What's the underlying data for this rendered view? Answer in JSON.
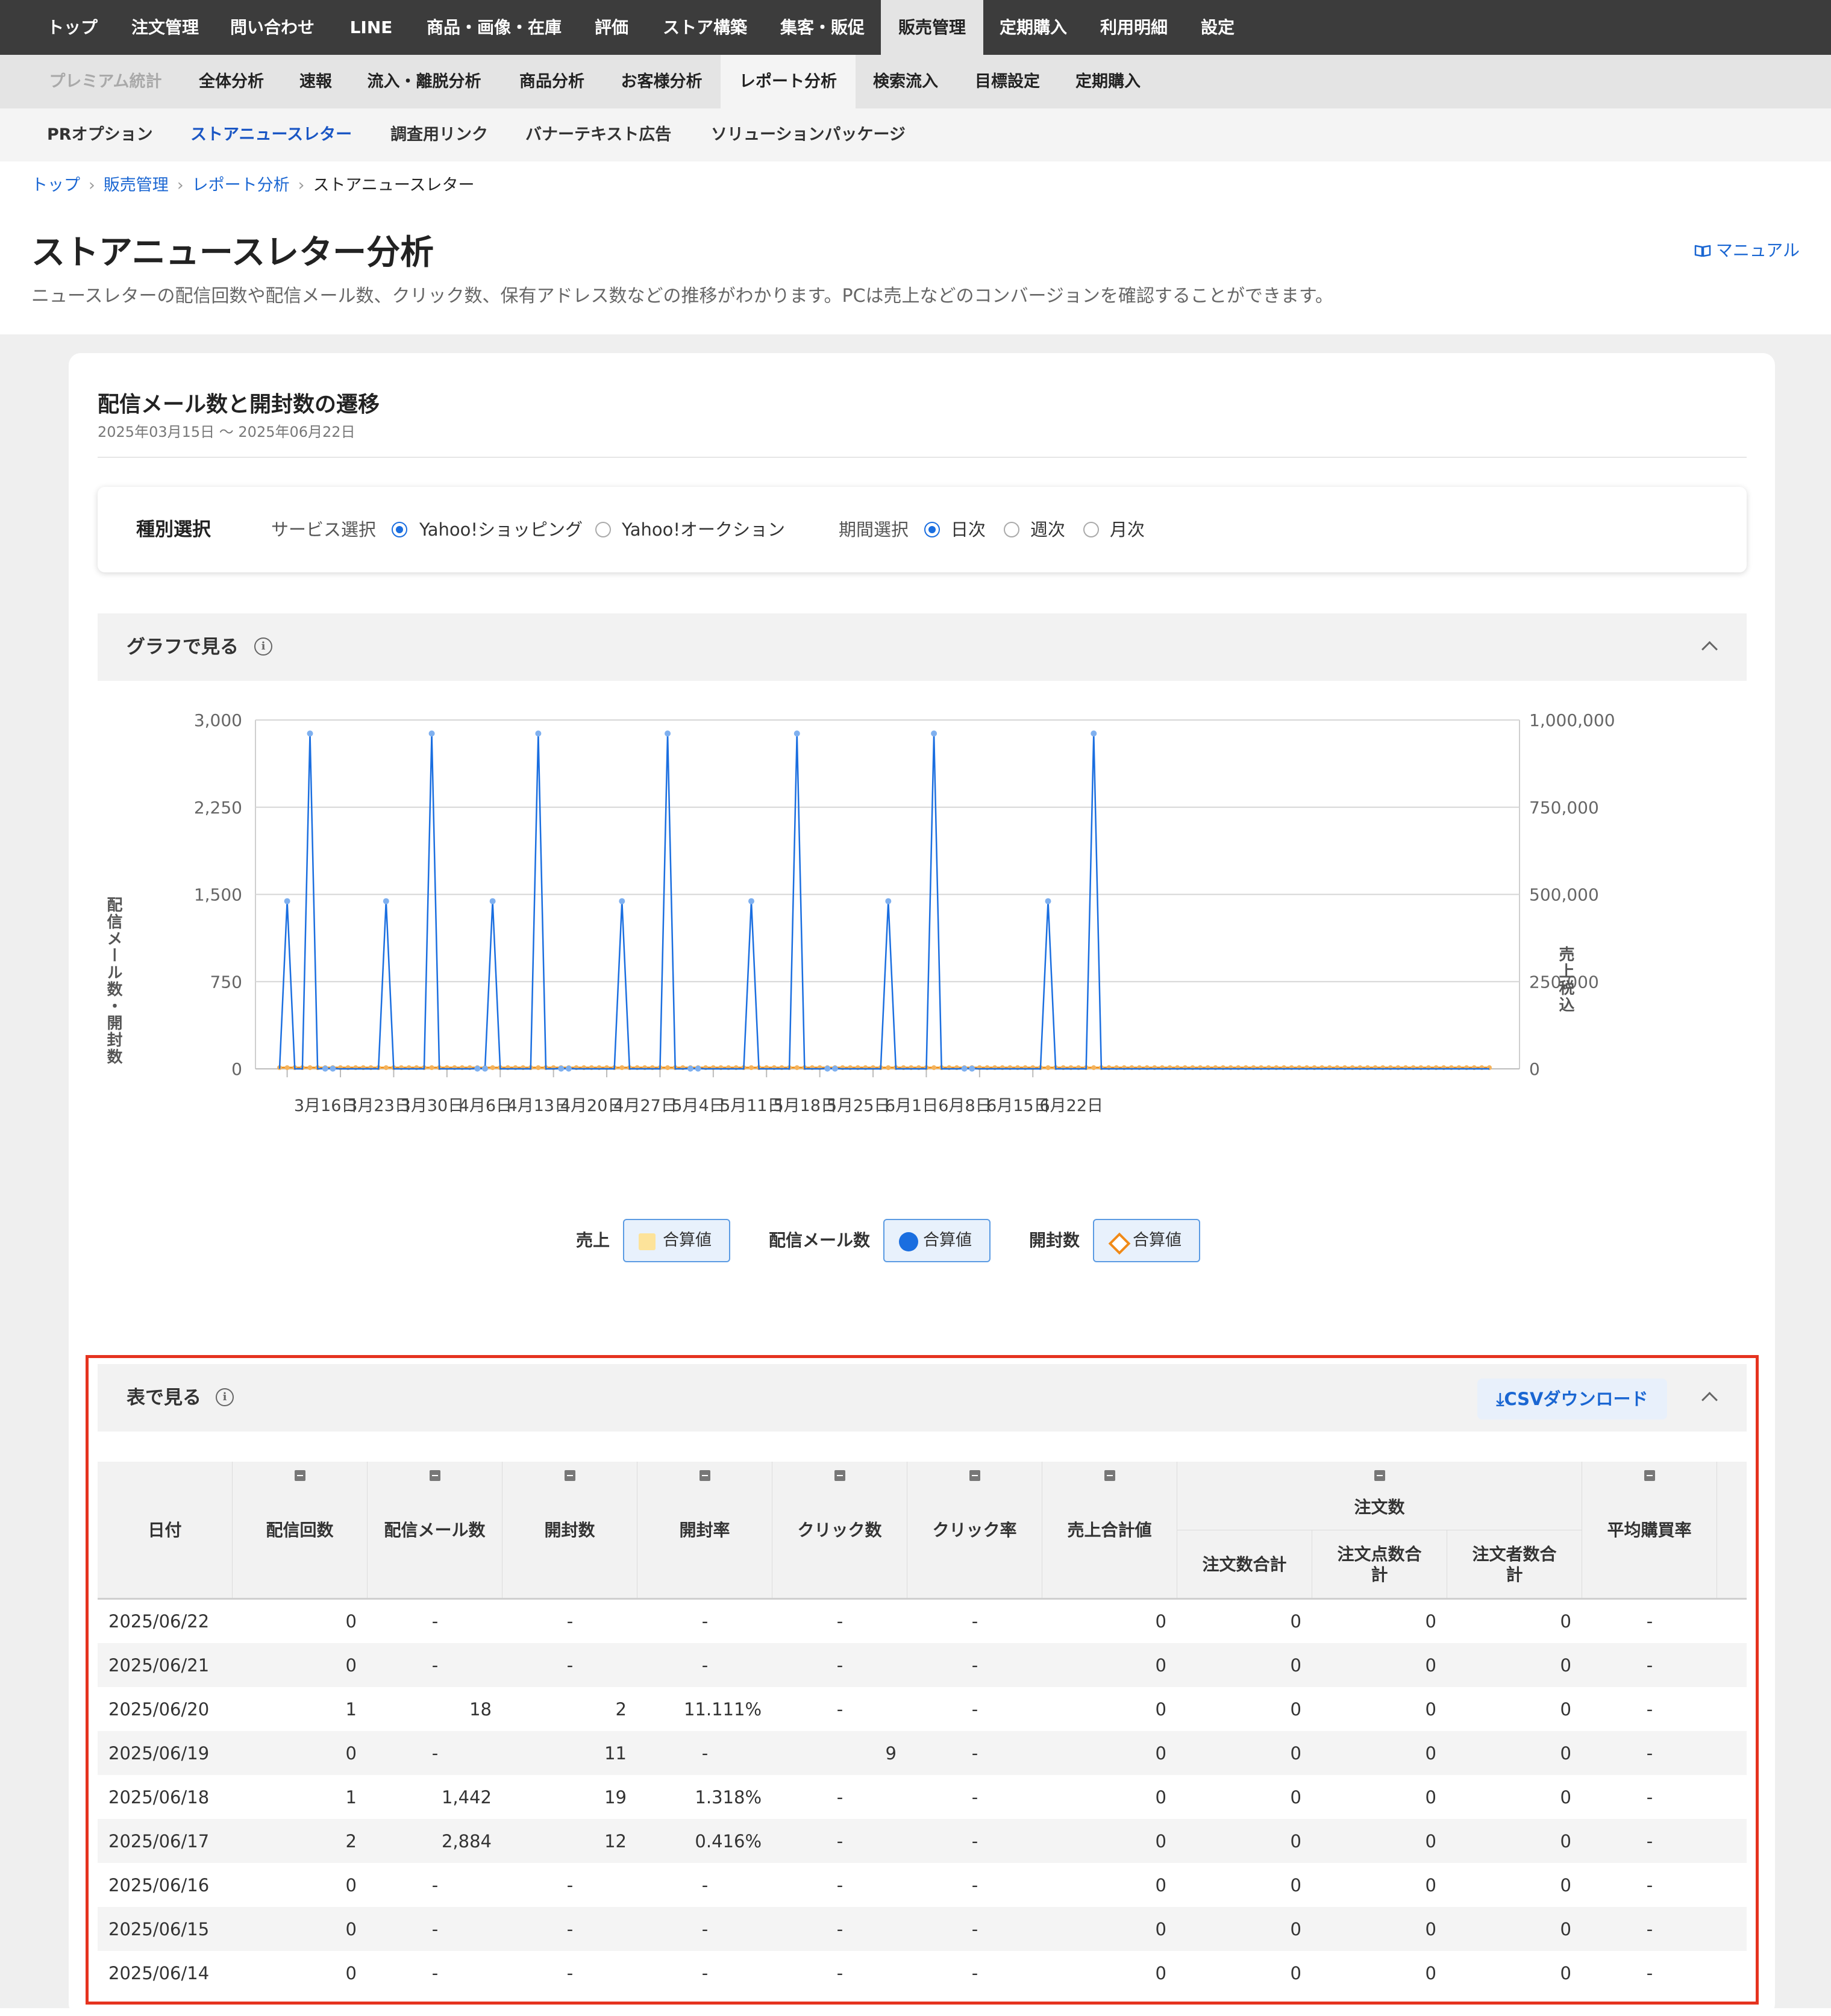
{
  "nav": {
    "main": [
      "トップ",
      "注文管理",
      "問い合わせ",
      "LINE",
      "商品・画像・在庫",
      "評価",
      "ストア構築",
      "集客・販促",
      "販売管理",
      "定期購入",
      "利用明細",
      "設定"
    ],
    "main_active": "販売管理",
    "sub": [
      "プレミアム統計",
      "全体分析",
      "速報",
      "流入・離脱分析",
      "商品分析",
      "お客様分析",
      "レポート分析",
      "検索流入",
      "目標設定",
      "定期購入"
    ],
    "sub_active": "レポート分析",
    "third": [
      "PRオプション",
      "ストアニュースレター",
      "調査用リンク",
      "バナーテキスト広告",
      "ソリューションパッケージ"
    ],
    "third_active": "ストアニュースレター"
  },
  "breadcrumb": [
    "トップ",
    "販売管理",
    "レポート分析",
    "ストアニュースレター"
  ],
  "page": {
    "title": "ストアニュースレター分析",
    "description": "ニュースレターの配信回数や配信メール数、クリック数、保有アドレス数などの推移がわかります。PCは売上などのコンバージョンを確認することができます。",
    "manual_link": "マニュアル"
  },
  "section": {
    "title": "配信メール数と開封数の遷移",
    "date_range": "2025年03月15日 〜 2025年06月22日"
  },
  "filter": {
    "label": "種別選択",
    "service_label": "サービス選択",
    "service_options": [
      "Yahoo!ショッピング",
      "Yahoo!オークション"
    ],
    "service_selected": "Yahoo!ショッピング",
    "period_label": "期間選択",
    "period_options": [
      "日次",
      "週次",
      "月次"
    ],
    "period_selected": "日次"
  },
  "graph_section": {
    "title": "グラフで見る",
    "info_icon": "info-icon",
    "collapse_icon": "chevron-up-icon"
  },
  "table_section": {
    "title": "表で見る",
    "csv_button": "CSVダウンロード",
    "info_icon": "info-icon",
    "collapse_icon": "chevron-up-icon"
  },
  "legend": [
    {
      "group": "売上",
      "item": "合算値",
      "color": "#fde39a",
      "marker": "square"
    },
    {
      "group": "配信メール数",
      "item": "合算値",
      "color": "#1a6ee0",
      "marker": "circle"
    },
    {
      "group": "開封数",
      "item": "合算値",
      "color": "#f08a18",
      "marker": "diamond"
    }
  ],
  "chart_data": {
    "type": "line",
    "title": "",
    "ylabel": "配信メール数・開封数",
    "y2label": "売上税込",
    "ylim": [
      0,
      3000
    ],
    "y2lim": [
      0,
      1000000
    ],
    "yticks": [
      "3,000",
      "2,250",
      "1,500",
      "750",
      "0"
    ],
    "y2ticks": [
      "1,000,000",
      "750,000",
      "500,000",
      "250,000",
      "0"
    ],
    "x_tick_labels": [
      "3月16日",
      "3月23日",
      "3月30日",
      "4月6日",
      "4月13日",
      "4月20日",
      "4月27日",
      "5月4日",
      "5月11日",
      "5月18日",
      "5月25日",
      "6月1日",
      "6月8日",
      "6月15日",
      "6月22日"
    ],
    "x_start": "2025-03-15",
    "x_end": "2025-06-22",
    "grid": true,
    "series": [
      {
        "name": "配信メール数",
        "color": "#1a6ee0",
        "values": [
          0,
          1442,
          0,
          0,
          2884,
          0,
          2,
          2,
          0,
          0,
          0,
          0,
          0,
          0,
          1442,
          0,
          0,
          0,
          0,
          0,
          2884,
          0,
          0,
          0,
          0,
          0,
          2,
          2,
          1442,
          0,
          0,
          0,
          0,
          0,
          2884,
          0,
          0,
          2,
          2,
          0,
          0,
          0,
          0,
          0,
          0,
          1442,
          0,
          0,
          0,
          0,
          0,
          2884,
          0,
          0,
          2,
          2,
          0,
          0,
          0,
          0,
          0,
          0,
          1442,
          0,
          0,
          0,
          0,
          0,
          2884,
          0,
          0,
          0,
          2,
          2,
          0,
          0,
          0,
          0,
          0,
          0,
          1442,
          0,
          0,
          0,
          0,
          0,
          2884,
          0,
          0,
          0,
          2,
          2,
          0,
          0,
          0,
          0,
          0,
          0,
          0,
          0,
          0,
          1442,
          0,
          0,
          0,
          0,
          0,
          2884,
          0,
          0,
          0,
          0,
          0,
          0,
          0,
          0,
          0,
          0,
          0,
          0,
          0,
          0,
          0,
          0,
          0,
          0,
          0,
          0,
          0,
          0,
          0,
          0,
          0,
          0,
          0,
          0,
          0,
          0,
          0,
          0,
          0,
          0,
          0,
          0,
          0,
          0,
          0,
          0,
          0,
          0,
          0,
          0,
          0,
          0,
          0,
          0,
          0,
          0,
          0,
          0
        ]
      },
      {
        "name": "開封数",
        "color": "#f08a18",
        "values": "~10 per day"
      },
      {
        "name": "売上",
        "color": "#fde39a",
        "values": "0"
      }
    ]
  },
  "table": {
    "columns": [
      "日付",
      "配信回数",
      "配信メール数",
      "開封数",
      "開封率",
      "クリック数",
      "クリック率",
      "売上合計値",
      "注文数合計",
      "注文点数合計",
      "注文者数合計",
      "平均購買率"
    ],
    "group_header": "注文数",
    "rows": [
      [
        "2025/06/22",
        "0",
        "-",
        "-",
        "-",
        "-",
        "-",
        "0",
        "0",
        "0",
        "0",
        "-"
      ],
      [
        "2025/06/21",
        "0",
        "-",
        "-",
        "-",
        "-",
        "-",
        "0",
        "0",
        "0",
        "0",
        "-"
      ],
      [
        "2025/06/20",
        "1",
        "18",
        "2",
        "11.111%",
        "-",
        "-",
        "0",
        "0",
        "0",
        "0",
        "-"
      ],
      [
        "2025/06/19",
        "0",
        "-",
        "11",
        "-",
        "9",
        "-",
        "0",
        "0",
        "0",
        "0",
        "-"
      ],
      [
        "2025/06/18",
        "1",
        "1,442",
        "19",
        "1.318%",
        "-",
        "-",
        "0",
        "0",
        "0",
        "0",
        "-"
      ],
      [
        "2025/06/17",
        "2",
        "2,884",
        "12",
        "0.416%",
        "-",
        "-",
        "0",
        "0",
        "0",
        "0",
        "-"
      ],
      [
        "2025/06/16",
        "0",
        "-",
        "-",
        "-",
        "-",
        "-",
        "0",
        "0",
        "0",
        "0",
        "-"
      ],
      [
        "2025/06/15",
        "0",
        "-",
        "-",
        "-",
        "-",
        "-",
        "0",
        "0",
        "0",
        "0",
        "-"
      ],
      [
        "2025/06/14",
        "0",
        "-",
        "-",
        "-",
        "-",
        "-",
        "0",
        "0",
        "0",
        "0",
        "-"
      ]
    ]
  }
}
